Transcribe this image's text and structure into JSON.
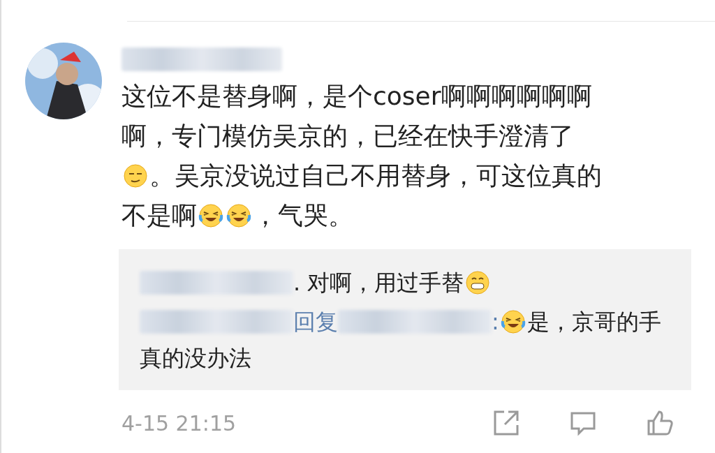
{
  "comment": {
    "author": {
      "kind": "blurred"
    },
    "lines": [
      [
        {
          "kind": "text",
          "text": "这位不是替身啊，是个coser啊啊啊啊啊啊"
        }
      ],
      [
        {
          "kind": "text",
          "text": "啊，专门模仿吴京的，已经在快手澄清了"
        }
      ],
      [
        {
          "kind": "smirk"
        },
        {
          "kind": "text",
          "text": "。吴京没说过自己不用替身，可这位真的"
        }
      ],
      [
        {
          "kind": "text",
          "text": "不是啊"
        },
        {
          "kind": "tears"
        },
        {
          "kind": "tears"
        },
        {
          "kind": "text",
          "text": "，气哭。"
        }
      ]
    ],
    "replies": [
      {
        "lines": [
          [
            {
              "kind": "blurred"
            },
            {
              "kind": "text",
              "text": ". 对啊，用过手替"
            },
            {
              "kind": "grin"
            }
          ]
        ]
      },
      {
        "lines": [
          [
            {
              "kind": "blurred"
            },
            {
              "kind": "link",
              "text": "回复"
            },
            {
              "kind": "blurred"
            },
            {
              "kind": "link",
              "text": ":"
            },
            {
              "kind": "tears"
            },
            {
              "kind": "text",
              "text": "是，京哥的手"
            }
          ],
          [
            {
              "kind": "text",
              "text": "真的没办法"
            }
          ]
        ]
      }
    ],
    "time": "4-15 21:15",
    "actions": [
      {
        "kind": "share"
      },
      {
        "kind": "comment"
      },
      {
        "kind": "like"
      }
    ]
  }
}
